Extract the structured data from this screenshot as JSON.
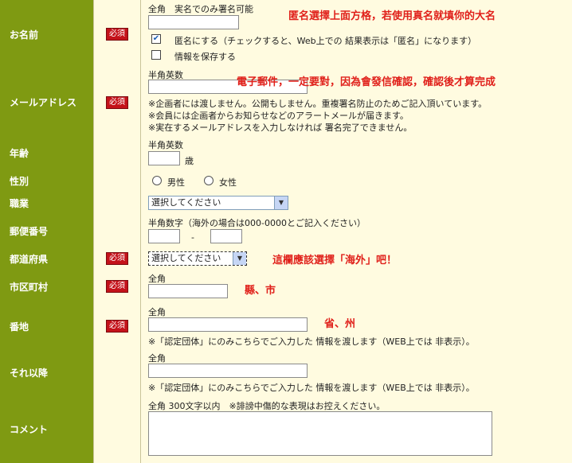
{
  "badge_required": "必須",
  "rows": {
    "name": {
      "label": "お名前",
      "hint": "全角　実名でのみ署名可能",
      "annotation": "匿名選擇上面方格，若使用真名就填你的大名",
      "anonymous_checked": true,
      "anonymous_label": "匿名にする（チェックすると、Web上での 結果表示は「匿名」になります）",
      "save_checked": false,
      "save_label": "情報を保存する"
    },
    "email": {
      "label": "メールアドレス",
      "hint": "半角英数",
      "annotation": "電子郵件，一定要對，因為會發信確認，確認後才算完成",
      "notes": [
        "※企画者には渡しません。公開もしません。重複署名防止のためご記入頂いています。",
        "※会員には企画者からお知らせなどのアラートメールが届きます。",
        "※実在するメールアドレスを入力しなければ 署名完了できません。"
      ]
    },
    "age": {
      "label": "年齢",
      "hint": "半角英数",
      "unit": "歳"
    },
    "gender": {
      "label": "性別",
      "male": "男性",
      "female": "女性"
    },
    "job": {
      "label": "職業",
      "select_value": "選択してください"
    },
    "postal": {
      "label": "郵便番号",
      "hint": "半角数字（海外の場合は000-0000とご記入ください）",
      "dash": "-"
    },
    "prefecture": {
      "label": "都道府県",
      "select_value": "選択してください",
      "annotation": "這欄應該選擇「海外」吧！"
    },
    "city": {
      "label": "市区町村",
      "hint": "全角",
      "annotation": "縣、市"
    },
    "address": {
      "label": "番地",
      "hint": "全角",
      "annotation": "省、州",
      "note": "※「認定団体」にのみこちらでご入力した 情報を渡します（WEB上では 非表示）。"
    },
    "after": {
      "label": "それ以降",
      "hint": "全角",
      "note": "※「認定団体」にのみこちらでご入力した 情報を渡します（WEB上では 非表示）。"
    },
    "comment": {
      "label": "コメント",
      "hint": "全角 300文字以内　※誹謗中傷的な表現はお控えください。"
    }
  },
  "colors": {
    "label_bg": "#7f9a12",
    "badge_bg": "#c4121a",
    "annotation": "#e0201a",
    "content_bg": "#fffbe0"
  }
}
